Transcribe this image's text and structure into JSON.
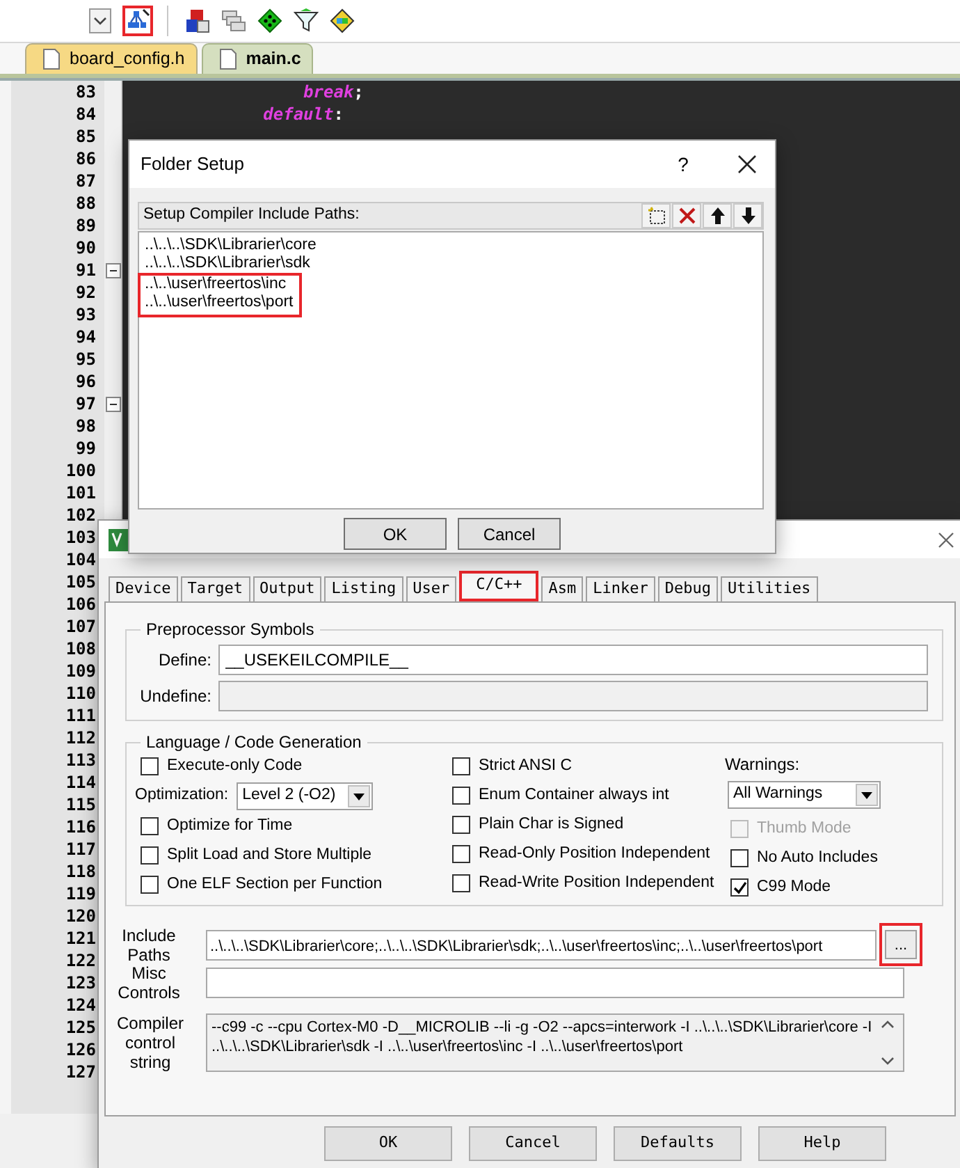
{
  "toolbar": [
    {
      "kind": "dropdown",
      "highlighted": false
    },
    {
      "kind": "wizard",
      "highlighted": true
    },
    {
      "kind": "blocks",
      "highlighted": false
    },
    {
      "kind": "windows",
      "highlighted": false
    },
    {
      "kind": "diamond",
      "highlighted": false
    },
    {
      "kind": "funnel",
      "highlighted": false
    },
    {
      "kind": "grid",
      "highlighted": false
    }
  ],
  "file_tabs": [
    {
      "label": "board_config.h",
      "selected": false
    },
    {
      "label": "main.c",
      "selected": true
    }
  ],
  "editor": {
    "lines": [
      {
        "number": "83",
        "fold": false,
        "code": [
          {
            "kind": "keyword",
            "text": "break"
          },
          {
            "kind": "plain",
            "text": ";"
          }
        ]
      },
      {
        "number": "84",
        "fold": false,
        "code": [
          {
            "kind": "keyword",
            "text": "default"
          },
          {
            "kind": "plain",
            "text": ":"
          }
        ]
      },
      {
        "number": "85",
        "fold": false
      },
      {
        "number": "86",
        "fold": false
      },
      {
        "number": "87",
        "fold": false
      },
      {
        "number": "88",
        "fold": false
      },
      {
        "number": "89",
        "fold": false
      },
      {
        "number": "90",
        "fold": false
      },
      {
        "number": "91",
        "fold": true
      },
      {
        "number": "92",
        "fold": false
      },
      {
        "number": "93",
        "fold": false
      },
      {
        "number": "94",
        "fold": false
      },
      {
        "number": "95",
        "fold": false
      },
      {
        "number": "96",
        "fold": false
      },
      {
        "number": "97",
        "fold": true
      },
      {
        "number": "98",
        "fold": false
      },
      {
        "number": "99",
        "fold": false
      },
      {
        "number": "100",
        "fold": false
      },
      {
        "number": "101",
        "fold": false
      },
      {
        "number": "102",
        "fold": false
      },
      {
        "number": "103",
        "fold": false
      },
      {
        "number": "104",
        "fold": false
      },
      {
        "number": "105",
        "fold": false
      },
      {
        "number": "106",
        "fold": false
      },
      {
        "number": "107",
        "fold": false
      },
      {
        "number": "108",
        "fold": false
      },
      {
        "number": "109",
        "fold": false
      },
      {
        "number": "110",
        "fold": false
      },
      {
        "number": "111",
        "fold": false
      },
      {
        "number": "112",
        "fold": false
      },
      {
        "number": "113",
        "fold": false
      },
      {
        "number": "114",
        "fold": false
      },
      {
        "number": "115",
        "fold": false
      },
      {
        "number": "116",
        "fold": false
      },
      {
        "number": "117",
        "fold": false
      },
      {
        "number": "118",
        "fold": false
      },
      {
        "number": "119",
        "fold": false
      },
      {
        "number": "120",
        "fold": false
      },
      {
        "number": "121",
        "fold": false
      },
      {
        "number": "122",
        "fold": false
      },
      {
        "number": "123",
        "fold": false
      },
      {
        "number": "124",
        "fold": false
      },
      {
        "number": "125",
        "fold": false
      },
      {
        "number": "126",
        "fold": false
      },
      {
        "number": "127",
        "fold": false
      }
    ]
  },
  "options_dialog": {
    "tabs": [
      {
        "label": "Device",
        "selected": false,
        "highlighted": false
      },
      {
        "label": "Target",
        "selected": false,
        "highlighted": false
      },
      {
        "label": "Output",
        "selected": false,
        "highlighted": false
      },
      {
        "label": "Listing",
        "selected": false,
        "highlighted": false
      },
      {
        "label": "User",
        "selected": false,
        "highlighted": false
      },
      {
        "label": "C/C++",
        "selected": true,
        "highlighted": true
      },
      {
        "label": "Asm",
        "selected": false,
        "highlighted": false
      },
      {
        "label": "Linker",
        "selected": false,
        "highlighted": false
      },
      {
        "label": "Debug",
        "selected": false,
        "highlighted": false
      },
      {
        "label": "Utilities",
        "selected": false,
        "highlighted": false
      }
    ],
    "preprocessor": {
      "title": "Preprocessor Symbols",
      "fields": [
        {
          "label": "Define:",
          "value": "__USEKEILCOMPILE__",
          "disabled": false
        },
        {
          "label": "Undefine:",
          "disabled": true
        }
      ]
    },
    "language": {
      "title": "Language / Code Generation",
      "columns": [
        [
          {
            "kind": "checkbox",
            "label": "Execute-only Code",
            "checked": false,
            "disabled": false
          },
          {
            "kind": "select",
            "label": "Optimization:",
            "value": "Level 2 (-O2)"
          },
          {
            "kind": "checkbox",
            "label": "Optimize for Time",
            "checked": false,
            "disabled": false
          },
          {
            "kind": "checkbox",
            "label": "Split Load and Store Multiple",
            "checked": false,
            "disabled": false
          },
          {
            "kind": "checkbox",
            "label": "One ELF Section per Function",
            "checked": false,
            "disabled": false
          }
        ],
        [
          {
            "kind": "checkbox",
            "label": "Strict ANSI C",
            "checked": false,
            "disabled": false
          },
          {
            "kind": "checkbox",
            "label": "Enum Container always int",
            "checked": false,
            "disabled": false
          },
          {
            "kind": "checkbox",
            "label": "Plain Char is Signed",
            "checked": false,
            "disabled": false
          },
          {
            "kind": "checkbox",
            "label": "Read-Only Position Independent",
            "checked": false,
            "disabled": false
          },
          {
            "kind": "checkbox",
            "label": "Read-Write Position Independent",
            "checked": false,
            "disabled": false
          }
        ],
        [
          {
            "kind": "select_stacked",
            "label": "Warnings:",
            "value": "All Warnings"
          },
          {
            "kind": "checkbox",
            "label": "Thumb Mode",
            "checked": false,
            "disabled": true
          },
          {
            "kind": "checkbox",
            "label": "No Auto Includes",
            "checked": false,
            "disabled": false
          },
          {
            "kind": "checkbox",
            "label": "C99 Mode",
            "checked": true,
            "disabled": false
          }
        ]
      ]
    },
    "include_paths": {
      "label": "Include Paths",
      "value": "..\\..\\..\\SDK\\Librarier\\core;..\\..\\..\\SDK\\Librarier\\sdk;..\\..\\user\\freertos\\inc;..\\..\\user\\freertos\\port",
      "browse": "...",
      "browse_highlighted": true
    },
    "misc_controls": {
      "label": "Misc Controls"
    },
    "compiler_string": {
      "label": "Compiler control string",
      "value": "--c99 -c --cpu Cortex-M0 -D__MICROLIB --li -g -O2 --apcs=interwork -I ..\\..\\..\\SDK\\Librarier\\core -I ..\\..\\..\\SDK\\Librarier\\sdk -I ..\\..\\user\\freertos\\inc -I ..\\..\\user\\freertos\\port"
    },
    "buttons": [
      "OK",
      "Cancel",
      "Defaults",
      "Help"
    ]
  },
  "folder_setup": {
    "title": "Folder Setup",
    "help": "?",
    "list_title": "Setup Compiler Include Paths:",
    "paths": [
      {
        "text": "..\\..\\..\\SDK\\Librarier\\core",
        "highlighted": false
      },
      {
        "text": "..\\..\\..\\SDK\\Librarier\\sdk",
        "highlighted": false
      },
      {
        "text": "..\\..\\user\\freertos\\inc",
        "highlighted": true
      },
      {
        "text": "..\\..\\user\\freertos\\port",
        "highlighted": true
      }
    ],
    "buttons": [
      "OK",
      "Cancel"
    ]
  }
}
